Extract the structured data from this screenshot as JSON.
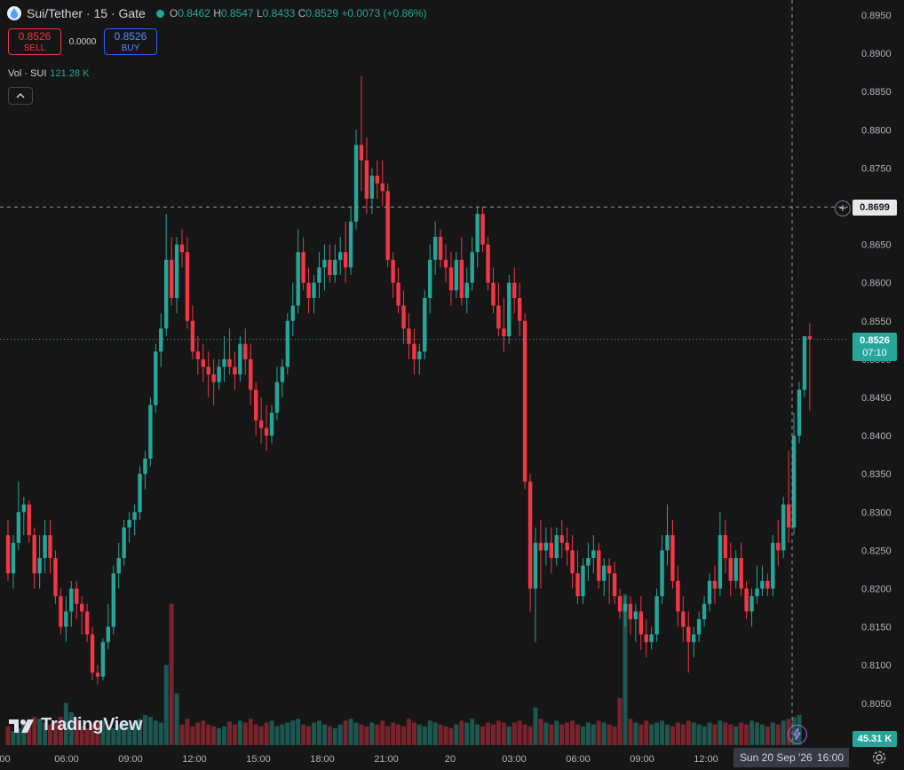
{
  "header": {
    "symbol": "Sui/Tether · 15 · Gate",
    "open_label": "O",
    "open": "0.8462",
    "high_label": "H",
    "high": "0.8547",
    "low_label": "L",
    "low": "0.8433",
    "close_label": "C",
    "close": "0.8529",
    "change": "+0.0073 (+0.86%)"
  },
  "trade": {
    "sell_price": "0.8526",
    "sell_label": "SELL",
    "spread": "0.0000",
    "buy_price": "0.8526",
    "buy_label": "BUY"
  },
  "volume": {
    "label": "Vol · SUI",
    "value": "121.28 K"
  },
  "brand": "TradingView",
  "price_axis": {
    "ticks": [
      "0.8950",
      "0.8900",
      "0.8850",
      "0.8800",
      "0.8750",
      "0.8700",
      "0.8650",
      "0.8600",
      "0.8550",
      "0.8500",
      "0.8450",
      "0.8400",
      "0.8350",
      "0.8300",
      "0.8250",
      "0.8200",
      "0.8150",
      "0.8100",
      "0.8050"
    ],
    "crosshair_price": "0.8699",
    "last_price": "0.8526",
    "countdown": "07:10",
    "volume_tag": "45.31 K"
  },
  "time_axis": {
    "ticks": [
      ":00",
      "06:00",
      "09:00",
      "12:00",
      "15:00",
      "18:00",
      "21:00",
      "20",
      "03:00",
      "06:00",
      "09:00",
      "12:00"
    ],
    "crosshair_date": "Sun 20 Sep '26",
    "crosshair_time": "16:00"
  },
  "colors": {
    "up": "#26a69a",
    "down": "#f23645",
    "background": "#161616"
  },
  "chart_data": {
    "type": "candlestick",
    "ylim": [
      0.8025,
      0.8975
    ],
    "candles": [
      {
        "o": 0.827,
        "h": 0.829,
        "l": 0.821,
        "c": 0.822
      },
      {
        "o": 0.822,
        "h": 0.827,
        "l": 0.82,
        "c": 0.826
      },
      {
        "o": 0.826,
        "h": 0.834,
        "l": 0.825,
        "c": 0.83
      },
      {
        "o": 0.83,
        "h": 0.832,
        "l": 0.827,
        "c": 0.831
      },
      {
        "o": 0.831,
        "h": 0.8315,
        "l": 0.826,
        "c": 0.827
      },
      {
        "o": 0.827,
        "h": 0.828,
        "l": 0.82,
        "c": 0.822
      },
      {
        "o": 0.822,
        "h": 0.827,
        "l": 0.82,
        "c": 0.824
      },
      {
        "o": 0.824,
        "h": 0.829,
        "l": 0.822,
        "c": 0.827
      },
      {
        "o": 0.827,
        "h": 0.829,
        "l": 0.822,
        "c": 0.824
      },
      {
        "o": 0.824,
        "h": 0.825,
        "l": 0.818,
        "c": 0.819
      },
      {
        "o": 0.819,
        "h": 0.82,
        "l": 0.814,
        "c": 0.815
      },
      {
        "o": 0.815,
        "h": 0.819,
        "l": 0.813,
        "c": 0.817
      },
      {
        "o": 0.817,
        "h": 0.821,
        "l": 0.815,
        "c": 0.82
      },
      {
        "o": 0.82,
        "h": 0.821,
        "l": 0.816,
        "c": 0.818
      },
      {
        "o": 0.818,
        "h": 0.819,
        "l": 0.814,
        "c": 0.817
      },
      {
        "o": 0.817,
        "h": 0.818,
        "l": 0.813,
        "c": 0.814
      },
      {
        "o": 0.814,
        "h": 0.815,
        "l": 0.808,
        "c": 0.809
      },
      {
        "o": 0.809,
        "h": 0.81,
        "l": 0.8075,
        "c": 0.8085
      },
      {
        "o": 0.8085,
        "h": 0.8135,
        "l": 0.808,
        "c": 0.813
      },
      {
        "o": 0.813,
        "h": 0.818,
        "l": 0.812,
        "c": 0.815
      },
      {
        "o": 0.815,
        "h": 0.823,
        "l": 0.814,
        "c": 0.822
      },
      {
        "o": 0.822,
        "h": 0.826,
        "l": 0.82,
        "c": 0.824
      },
      {
        "o": 0.824,
        "h": 0.829,
        "l": 0.823,
        "c": 0.828
      },
      {
        "o": 0.828,
        "h": 0.83,
        "l": 0.826,
        "c": 0.829
      },
      {
        "o": 0.829,
        "h": 0.831,
        "l": 0.827,
        "c": 0.83
      },
      {
        "o": 0.83,
        "h": 0.836,
        "l": 0.829,
        "c": 0.835
      },
      {
        "o": 0.835,
        "h": 0.838,
        "l": 0.833,
        "c": 0.837
      },
      {
        "o": 0.837,
        "h": 0.845,
        "l": 0.836,
        "c": 0.844
      },
      {
        "o": 0.844,
        "h": 0.852,
        "l": 0.843,
        "c": 0.851
      },
      {
        "o": 0.851,
        "h": 0.856,
        "l": 0.849,
        "c": 0.854
      },
      {
        "o": 0.854,
        "h": 0.869,
        "l": 0.853,
        "c": 0.863
      },
      {
        "o": 0.863,
        "h": 0.866,
        "l": 0.857,
        "c": 0.858
      },
      {
        "o": 0.858,
        "h": 0.866,
        "l": 0.856,
        "c": 0.865
      },
      {
        "o": 0.865,
        "h": 0.867,
        "l": 0.862,
        "c": 0.864
      },
      {
        "o": 0.864,
        "h": 0.866,
        "l": 0.854,
        "c": 0.855
      },
      {
        "o": 0.855,
        "h": 0.857,
        "l": 0.85,
        "c": 0.851
      },
      {
        "o": 0.851,
        "h": 0.853,
        "l": 0.848,
        "c": 0.85
      },
      {
        "o": 0.85,
        "h": 0.852,
        "l": 0.847,
        "c": 0.849
      },
      {
        "o": 0.849,
        "h": 0.851,
        "l": 0.845,
        "c": 0.848
      },
      {
        "o": 0.848,
        "h": 0.85,
        "l": 0.844,
        "c": 0.847
      },
      {
        "o": 0.847,
        "h": 0.85,
        "l": 0.846,
        "c": 0.849
      },
      {
        "o": 0.849,
        "h": 0.853,
        "l": 0.847,
        "c": 0.85
      },
      {
        "o": 0.85,
        "h": 0.854,
        "l": 0.848,
        "c": 0.849
      },
      {
        "o": 0.849,
        "h": 0.851,
        "l": 0.846,
        "c": 0.848
      },
      {
        "o": 0.848,
        "h": 0.853,
        "l": 0.847,
        "c": 0.852
      },
      {
        "o": 0.852,
        "h": 0.854,
        "l": 0.848,
        "c": 0.85
      },
      {
        "o": 0.85,
        "h": 0.852,
        "l": 0.844,
        "c": 0.846
      },
      {
        "o": 0.846,
        "h": 0.847,
        "l": 0.84,
        "c": 0.842
      },
      {
        "o": 0.842,
        "h": 0.845,
        "l": 0.839,
        "c": 0.841
      },
      {
        "o": 0.841,
        "h": 0.844,
        "l": 0.838,
        "c": 0.84
      },
      {
        "o": 0.84,
        "h": 0.844,
        "l": 0.839,
        "c": 0.843
      },
      {
        "o": 0.843,
        "h": 0.849,
        "l": 0.842,
        "c": 0.847
      },
      {
        "o": 0.847,
        "h": 0.85,
        "l": 0.845,
        "c": 0.849
      },
      {
        "o": 0.849,
        "h": 0.856,
        "l": 0.848,
        "c": 0.855
      },
      {
        "o": 0.855,
        "h": 0.86,
        "l": 0.853,
        "c": 0.857
      },
      {
        "o": 0.857,
        "h": 0.867,
        "l": 0.856,
        "c": 0.864
      },
      {
        "o": 0.864,
        "h": 0.866,
        "l": 0.859,
        "c": 0.86
      },
      {
        "o": 0.86,
        "h": 0.862,
        "l": 0.856,
        "c": 0.858
      },
      {
        "o": 0.858,
        "h": 0.861,
        "l": 0.856,
        "c": 0.86
      },
      {
        "o": 0.86,
        "h": 0.864,
        "l": 0.858,
        "c": 0.862
      },
      {
        "o": 0.862,
        "h": 0.865,
        "l": 0.859,
        "c": 0.863
      },
      {
        "o": 0.863,
        "h": 0.865,
        "l": 0.86,
        "c": 0.861
      },
      {
        "o": 0.861,
        "h": 0.865,
        "l": 0.86,
        "c": 0.863
      },
      {
        "o": 0.863,
        "h": 0.866,
        "l": 0.861,
        "c": 0.864
      },
      {
        "o": 0.864,
        "h": 0.868,
        "l": 0.86,
        "c": 0.862
      },
      {
        "o": 0.862,
        "h": 0.87,
        "l": 0.861,
        "c": 0.868
      },
      {
        "o": 0.868,
        "h": 0.88,
        "l": 0.867,
        "c": 0.878
      },
      {
        "o": 0.878,
        "h": 0.887,
        "l": 0.872,
        "c": 0.876
      },
      {
        "o": 0.876,
        "h": 0.879,
        "l": 0.869,
        "c": 0.871
      },
      {
        "o": 0.871,
        "h": 0.875,
        "l": 0.869,
        "c": 0.874
      },
      {
        "o": 0.874,
        "h": 0.876,
        "l": 0.871,
        "c": 0.873
      },
      {
        "o": 0.873,
        "h": 0.876,
        "l": 0.87,
        "c": 0.872
      },
      {
        "o": 0.872,
        "h": 0.873,
        "l": 0.862,
        "c": 0.863
      },
      {
        "o": 0.863,
        "h": 0.864,
        "l": 0.858,
        "c": 0.86
      },
      {
        "o": 0.86,
        "h": 0.862,
        "l": 0.856,
        "c": 0.857
      },
      {
        "o": 0.857,
        "h": 0.859,
        "l": 0.852,
        "c": 0.854
      },
      {
        "o": 0.854,
        "h": 0.856,
        "l": 0.85,
        "c": 0.852
      },
      {
        "o": 0.852,
        "h": 0.854,
        "l": 0.848,
        "c": 0.85
      },
      {
        "o": 0.85,
        "h": 0.852,
        "l": 0.848,
        "c": 0.851
      },
      {
        "o": 0.851,
        "h": 0.859,
        "l": 0.85,
        "c": 0.858
      },
      {
        "o": 0.858,
        "h": 0.865,
        "l": 0.856,
        "c": 0.863
      },
      {
        "o": 0.863,
        "h": 0.868,
        "l": 0.861,
        "c": 0.866
      },
      {
        "o": 0.866,
        "h": 0.867,
        "l": 0.862,
        "c": 0.863
      },
      {
        "o": 0.863,
        "h": 0.865,
        "l": 0.86,
        "c": 0.862
      },
      {
        "o": 0.862,
        "h": 0.864,
        "l": 0.857,
        "c": 0.859
      },
      {
        "o": 0.859,
        "h": 0.864,
        "l": 0.858,
        "c": 0.863
      },
      {
        "o": 0.863,
        "h": 0.866,
        "l": 0.857,
        "c": 0.858
      },
      {
        "o": 0.858,
        "h": 0.862,
        "l": 0.856,
        "c": 0.86
      },
      {
        "o": 0.86,
        "h": 0.866,
        "l": 0.859,
        "c": 0.864
      },
      {
        "o": 0.864,
        "h": 0.87,
        "l": 0.862,
        "c": 0.869
      },
      {
        "o": 0.869,
        "h": 0.87,
        "l": 0.864,
        "c": 0.865
      },
      {
        "o": 0.865,
        "h": 0.866,
        "l": 0.859,
        "c": 0.86
      },
      {
        "o": 0.86,
        "h": 0.862,
        "l": 0.856,
        "c": 0.857
      },
      {
        "o": 0.857,
        "h": 0.86,
        "l": 0.853,
        "c": 0.854
      },
      {
        "o": 0.854,
        "h": 0.858,
        "l": 0.851,
        "c": 0.853
      },
      {
        "o": 0.853,
        "h": 0.861,
        "l": 0.852,
        "c": 0.86
      },
      {
        "o": 0.86,
        "h": 0.862,
        "l": 0.856,
        "c": 0.858
      },
      {
        "o": 0.858,
        "h": 0.86,
        "l": 0.853,
        "c": 0.855
      },
      {
        "o": 0.855,
        "h": 0.856,
        "l": 0.833,
        "c": 0.834
      },
      {
        "o": 0.834,
        "h": 0.835,
        "l": 0.817,
        "c": 0.82
      },
      {
        "o": 0.82,
        "h": 0.828,
        "l": 0.813,
        "c": 0.826
      },
      {
        "o": 0.826,
        "h": 0.829,
        "l": 0.82,
        "c": 0.825
      },
      {
        "o": 0.825,
        "h": 0.828,
        "l": 0.823,
        "c": 0.826
      },
      {
        "o": 0.826,
        "h": 0.828,
        "l": 0.822,
        "c": 0.824
      },
      {
        "o": 0.824,
        "h": 0.828,
        "l": 0.823,
        "c": 0.827
      },
      {
        "o": 0.827,
        "h": 0.829,
        "l": 0.824,
        "c": 0.826
      },
      {
        "o": 0.826,
        "h": 0.828,
        "l": 0.823,
        "c": 0.825
      },
      {
        "o": 0.825,
        "h": 0.827,
        "l": 0.82,
        "c": 0.822
      },
      {
        "o": 0.822,
        "h": 0.825,
        "l": 0.818,
        "c": 0.819
      },
      {
        "o": 0.819,
        "h": 0.824,
        "l": 0.818,
        "c": 0.823
      },
      {
        "o": 0.823,
        "h": 0.826,
        "l": 0.821,
        "c": 0.824
      },
      {
        "o": 0.824,
        "h": 0.827,
        "l": 0.822,
        "c": 0.825
      },
      {
        "o": 0.825,
        "h": 0.826,
        "l": 0.82,
        "c": 0.821
      },
      {
        "o": 0.821,
        "h": 0.824,
        "l": 0.819,
        "c": 0.823
      },
      {
        "o": 0.823,
        "h": 0.824,
        "l": 0.818,
        "c": 0.822
      },
      {
        "o": 0.822,
        "h": 0.8235,
        "l": 0.818,
        "c": 0.819
      },
      {
        "o": 0.819,
        "h": 0.82,
        "l": 0.816,
        "c": 0.817
      },
      {
        "o": 0.817,
        "h": 0.819,
        "l": 0.815,
        "c": 0.818
      },
      {
        "o": 0.818,
        "h": 0.819,
        "l": 0.814,
        "c": 0.816
      },
      {
        "o": 0.816,
        "h": 0.818,
        "l": 0.813,
        "c": 0.817
      },
      {
        "o": 0.817,
        "h": 0.819,
        "l": 0.812,
        "c": 0.814
      },
      {
        "o": 0.814,
        "h": 0.816,
        "l": 0.811,
        "c": 0.813
      },
      {
        "o": 0.813,
        "h": 0.815,
        "l": 0.812,
        "c": 0.814
      },
      {
        "o": 0.814,
        "h": 0.82,
        "l": 0.813,
        "c": 0.819
      },
      {
        "o": 0.819,
        "h": 0.827,
        "l": 0.818,
        "c": 0.825
      },
      {
        "o": 0.825,
        "h": 0.831,
        "l": 0.823,
        "c": 0.827
      },
      {
        "o": 0.827,
        "h": 0.829,
        "l": 0.82,
        "c": 0.821
      },
      {
        "o": 0.821,
        "h": 0.823,
        "l": 0.815,
        "c": 0.817
      },
      {
        "o": 0.817,
        "h": 0.819,
        "l": 0.813,
        "c": 0.815
      },
      {
        "o": 0.815,
        "h": 0.817,
        "l": 0.809,
        "c": 0.813
      },
      {
        "o": 0.813,
        "h": 0.815,
        "l": 0.811,
        "c": 0.814
      },
      {
        "o": 0.814,
        "h": 0.817,
        "l": 0.813,
        "c": 0.816
      },
      {
        "o": 0.816,
        "h": 0.819,
        "l": 0.815,
        "c": 0.818
      },
      {
        "o": 0.818,
        "h": 0.822,
        "l": 0.817,
        "c": 0.821
      },
      {
        "o": 0.821,
        "h": 0.823,
        "l": 0.818,
        "c": 0.82
      },
      {
        "o": 0.82,
        "h": 0.83,
        "l": 0.819,
        "c": 0.827
      },
      {
        "o": 0.827,
        "h": 0.829,
        "l": 0.822,
        "c": 0.824
      },
      {
        "o": 0.824,
        "h": 0.826,
        "l": 0.819,
        "c": 0.821
      },
      {
        "o": 0.821,
        "h": 0.825,
        "l": 0.82,
        "c": 0.824
      },
      {
        "o": 0.824,
        "h": 0.826,
        "l": 0.819,
        "c": 0.82
      },
      {
        "o": 0.82,
        "h": 0.821,
        "l": 0.816,
        "c": 0.817
      },
      {
        "o": 0.817,
        "h": 0.82,
        "l": 0.815,
        "c": 0.819
      },
      {
        "o": 0.819,
        "h": 0.823,
        "l": 0.818,
        "c": 0.82
      },
      {
        "o": 0.82,
        "h": 0.823,
        "l": 0.819,
        "c": 0.821
      },
      {
        "o": 0.821,
        "h": 0.822,
        "l": 0.819,
        "c": 0.82
      },
      {
        "o": 0.82,
        "h": 0.827,
        "l": 0.819,
        "c": 0.826
      },
      {
        "o": 0.826,
        "h": 0.829,
        "l": 0.823,
        "c": 0.825
      },
      {
        "o": 0.825,
        "h": 0.832,
        "l": 0.824,
        "c": 0.831
      },
      {
        "o": 0.831,
        "h": 0.838,
        "l": 0.826,
        "c": 0.828
      },
      {
        "o": 0.828,
        "h": 0.843,
        "l": 0.827,
        "c": 0.84
      },
      {
        "o": 0.84,
        "h": 0.847,
        "l": 0.839,
        "c": 0.846
      },
      {
        "o": 0.846,
        "h": 0.853,
        "l": 0.845,
        "c": 0.853
      },
      {
        "o": 0.853,
        "h": 0.8547,
        "l": 0.8433,
        "c": 0.8526
      }
    ],
    "volumes": [
      20,
      15,
      18,
      22,
      25,
      30,
      28,
      24,
      22,
      26,
      30,
      45,
      35,
      28,
      20,
      18,
      22,
      24,
      26,
      20,
      18,
      22,
      25,
      20,
      24,
      28,
      32,
      30,
      26,
      24,
      85,
      150,
      55,
      22,
      28,
      20,
      24,
      26,
      22,
      20,
      18,
      20,
      25,
      22,
      26,
      24,
      28,
      22,
      20,
      24,
      26,
      20,
      22,
      24,
      26,
      28,
      22,
      20,
      24,
      26,
      22,
      20,
      18,
      22,
      26,
      28,
      24,
      22,
      20,
      24,
      22,
      26,
      20,
      24,
      22,
      20,
      28,
      24,
      22,
      20,
      26,
      24,
      22,
      20,
      18,
      22,
      26,
      24,
      28,
      22,
      20,
      24,
      22,
      26,
      24,
      20,
      24,
      26,
      22,
      20,
      40,
      28,
      24,
      22,
      26,
      22,
      24,
      26,
      22,
      20,
      24,
      22,
      26,
      24,
      22,
      20,
      50,
      160,
      28,
      24,
      22,
      26,
      22,
      24,
      26,
      22,
      20,
      24,
      22,
      26,
      24,
      22,
      20,
      24,
      22,
      26,
      24,
      22,
      20,
      24,
      22,
      26,
      24,
      22,
      20,
      24,
      22,
      26,
      28,
      30,
      32
    ]
  }
}
